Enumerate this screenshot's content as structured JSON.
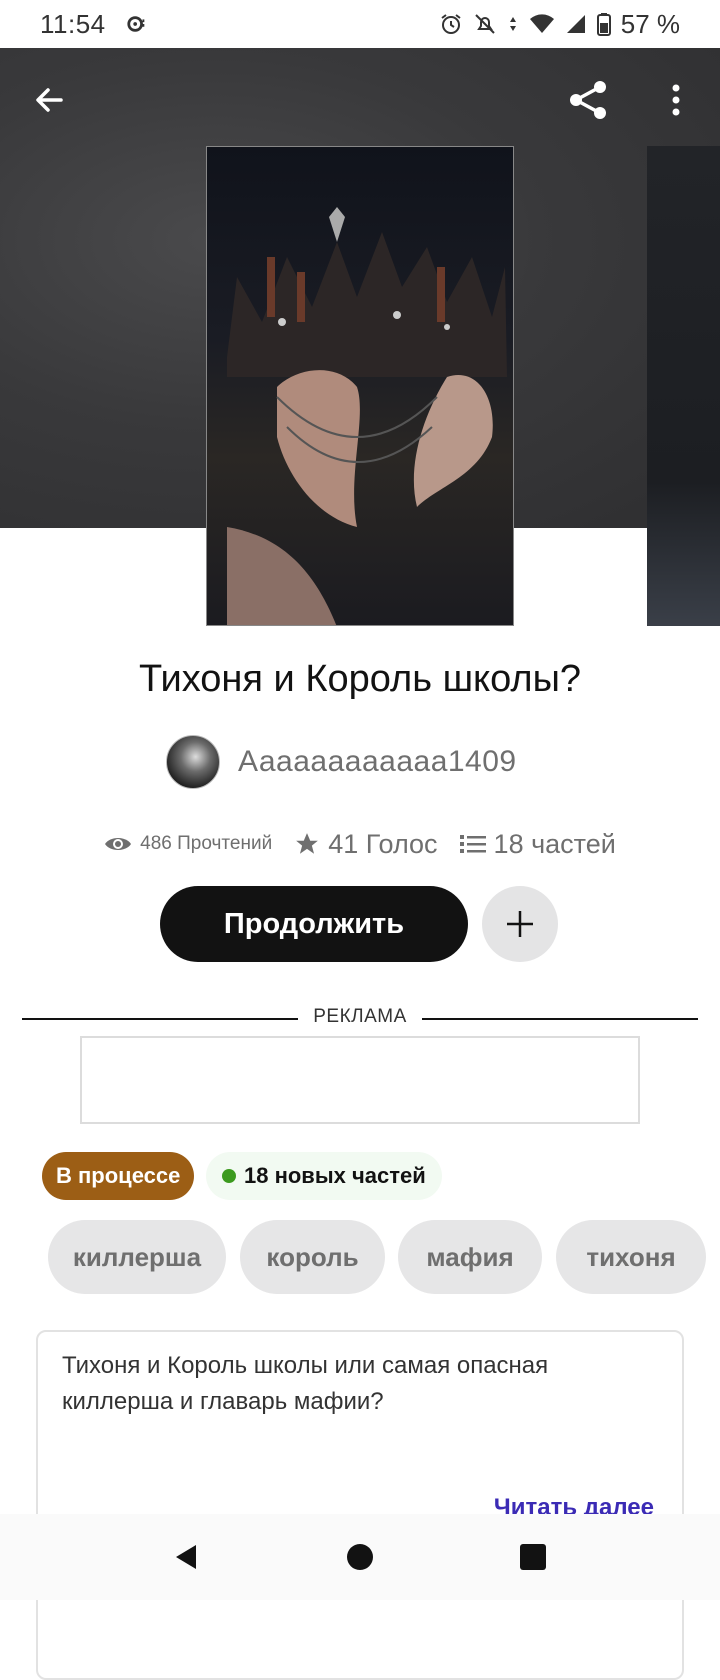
{
  "status_bar": {
    "time": "11:54",
    "battery": "57 %",
    "icons": [
      "alarm-icon",
      "mute-icon",
      "data-icon",
      "wifi-icon",
      "signal-icon",
      "battery-icon"
    ]
  },
  "toolbar": {
    "back_icon": "arrow-left-icon",
    "share_icon": "share-icon",
    "more_icon": "more-vert-icon"
  },
  "story": {
    "title": "Тихоня и Король школы?",
    "author": "Аааааааааааа1409",
    "reads": "486 Прочтений",
    "votes": "41 Голос",
    "parts": "18 частей"
  },
  "actions": {
    "continue_label": "Продолжить",
    "add_icon": "plus-icon"
  },
  "ad": {
    "label": "РЕКЛАМА"
  },
  "badges": {
    "status": "В процессе",
    "new_parts": "18 новых частей",
    "new_dot_color": "#3c9a1f",
    "status_color": "#9c5e15"
  },
  "tags": [
    "киллерша",
    "король",
    "мафия",
    "тихоня"
  ],
  "description": {
    "text": "Тихоня и Король школы или самая опасная киллерша и главарь мафии?",
    "read_more": "Читать далее"
  },
  "navbar": {
    "icons": [
      "nav-back-icon",
      "nav-home-icon",
      "nav-recents-icon"
    ]
  }
}
